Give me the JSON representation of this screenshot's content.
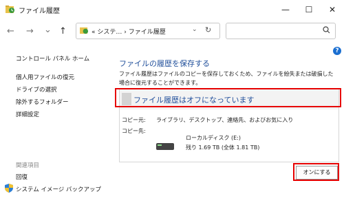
{
  "window": {
    "title": "ファイル履歴",
    "minimize": "—",
    "maximize": "☐",
    "close": "✕"
  },
  "toolbar": {
    "back": "←",
    "forward": "→",
    "recent": "⌄",
    "up": "↑",
    "address_path": "«  システ…  ›  ファイル履歴",
    "address_dropdown": "⌄",
    "refresh": "↻",
    "search_placeholder": ""
  },
  "sidebar": {
    "home": "コントロール パネル ホーム",
    "items": [
      {
        "label": "個人用ファイルの復元"
      },
      {
        "label": "ドライブの選択"
      },
      {
        "label": "除外するフォルダー"
      },
      {
        "label": "詳細設定"
      }
    ],
    "related_header": "関連項目",
    "related": [
      {
        "label": "回復"
      },
      {
        "label": "システム イメージ バックアップ"
      }
    ]
  },
  "main": {
    "heading": "ファイルの履歴を保存する",
    "description": "ファイル履歴はファイルのコピーを保存しておくため、ファイルを紛失または破損した場合に復元することができます。",
    "status": "ファイル履歴はオフになっています",
    "copy_from_label": "コピー元:",
    "copy_from_value": "ライブラリ、デスクトップ、連絡先、およびお気に入り",
    "copy_to_label": "コピー先:",
    "drive_name": "ローカルディスク (E:)",
    "drive_space": "残り 1.69 TB (全体 1.81 TB)",
    "turn_on_button": "オンにする"
  },
  "help_icon": "?",
  "colors": {
    "heading": "#1f4e9a",
    "highlight": "#e60000",
    "help": "#1b6fd1"
  }
}
